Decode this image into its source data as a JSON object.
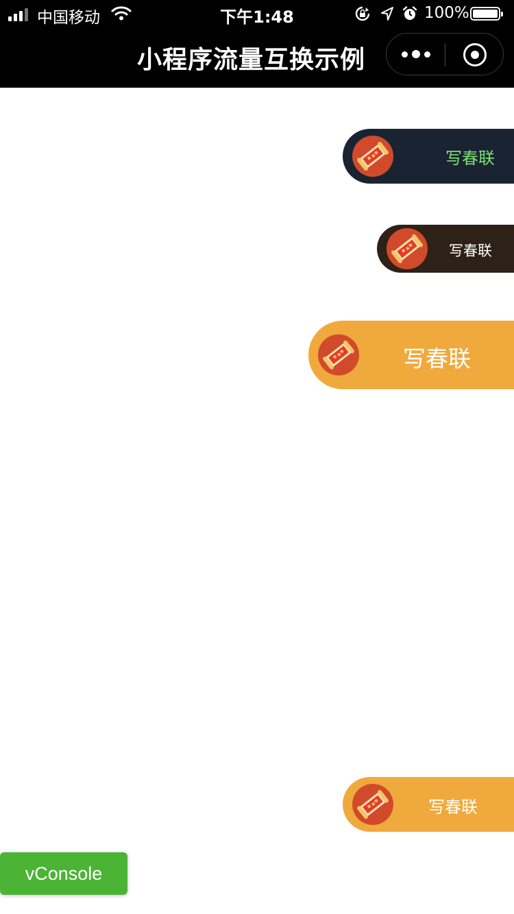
{
  "status_bar": {
    "carrier": "中国移动",
    "time": "下午1:48",
    "battery": "100%"
  },
  "nav": {
    "title": "小程序流量互换示例"
  },
  "promo_buttons": [
    {
      "label": "写春联",
      "bg": "#1a2332",
      "text_color": "#7de070"
    },
    {
      "label": "写春联",
      "bg": "#2e2117",
      "text_color": "#ffffff"
    },
    {
      "label": "写春联",
      "bg": "#f0a93c",
      "text_color": "#ffffff"
    },
    {
      "label": "写春联",
      "bg": "#f0a93c",
      "text_color": "#ffffff"
    }
  ],
  "icons": {
    "avatar": "spring-couplet-scroll-icon"
  },
  "vconsole": {
    "label": "vConsole",
    "bg": "#4bb435"
  }
}
